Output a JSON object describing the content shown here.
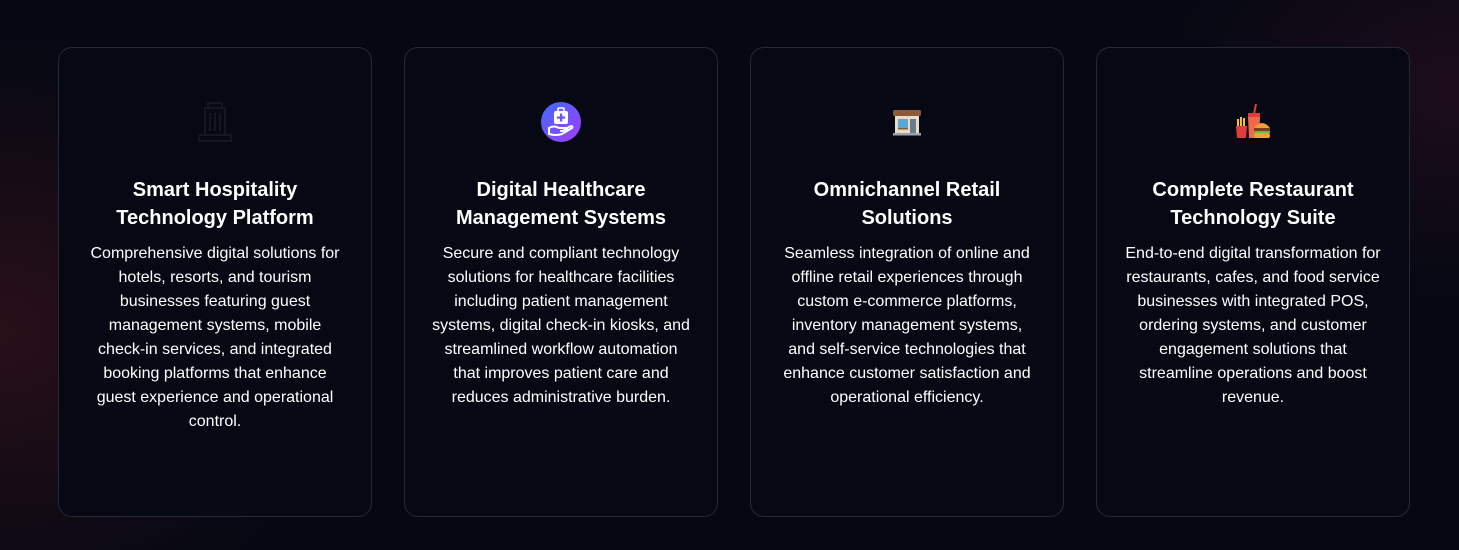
{
  "cards": [
    {
      "icon": "hotel-building-icon",
      "title": "Smart Hospitality Technology Platform",
      "description": "Comprehensive digital solutions for hotels, resorts, and tourism businesses featuring guest management systems, mobile check-in services, and integrated booking platforms that enhance guest experience and operational control."
    },
    {
      "icon": "medical-care-icon",
      "title": "Digital Healthcare Management Systems",
      "description": "Secure and compliant technology solutions for healthcare facilities including patient management systems, digital check-in kiosks, and streamlined workflow automation that improves patient care and reduces administrative burden."
    },
    {
      "icon": "storefront-icon",
      "title": "Omnichannel Retail Solutions",
      "description": "Seamless integration of online and offline retail experiences through custom e-commerce platforms, inventory management systems, and self-service technologies that enhance customer satisfaction and operational efficiency."
    },
    {
      "icon": "fast-food-icon",
      "title": "Complete Restaurant Technology Suite",
      "description": "End-to-end digital transformation for restaurants, cafes, and food service businesses with integrated POS, ordering systems, and customer engagement solutions that streamline operations and boost revenue."
    }
  ],
  "colors": {
    "background": "#050812",
    "card_border": "#262a36",
    "text": "#ffffff",
    "healthcare_icon": "#7c4dff"
  }
}
